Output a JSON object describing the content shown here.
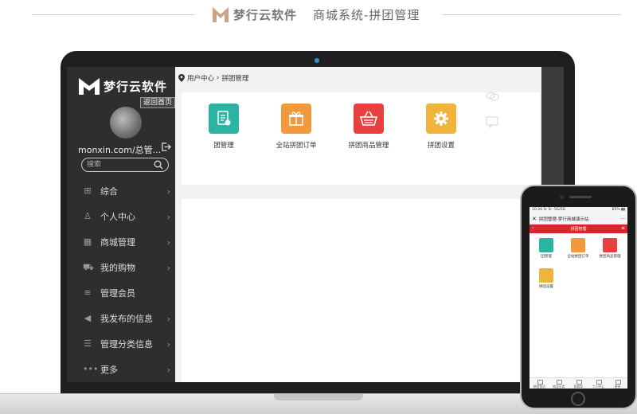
{
  "banner": {
    "brand": "梦行云软件",
    "subtitle": "商城系统-拼团管理"
  },
  "sidebar": {
    "brand": "梦行云软件",
    "return_label": "返回首页",
    "username": "monxin.com/总管...",
    "search_placeholder": "搜索",
    "items": [
      {
        "label": "综合",
        "icon": "grid-icon"
      },
      {
        "label": "个人中心",
        "icon": "user-icon"
      },
      {
        "label": "商城管理",
        "icon": "store-icon"
      },
      {
        "label": "我的购物",
        "icon": "cart-icon"
      },
      {
        "label": "管理会员",
        "icon": "layers-icon"
      },
      {
        "label": "我发布的信息",
        "icon": "megaphone-icon"
      },
      {
        "label": "管理分类信息",
        "icon": "list-icon"
      },
      {
        "label": "更多",
        "icon": "more-dots-icon"
      }
    ]
  },
  "breadcrumb": {
    "home": "用户中心",
    "separator": "›",
    "current": "拼团管理"
  },
  "tiles": [
    {
      "label": "团管理",
      "color": "#2bb3a4",
      "icon": "team-doc-icon"
    },
    {
      "label": "全站拼团订单",
      "color": "#f29a3b",
      "icon": "gift-icon"
    },
    {
      "label": "拼团商品管理",
      "color": "#e84040",
      "icon": "basket-icon"
    },
    {
      "label": "拼团设置",
      "color": "#f0b43c",
      "icon": "gear-icon"
    }
  ],
  "phone": {
    "status_left": "10:34 5r 5r ·5G/5G",
    "status_right": "85% ▮▮",
    "title": "拼团管理-梦行商城演示站",
    "bar_title": "拼团管理",
    "tiles": [
      {
        "label": "团管理",
        "color": "#2bb3a4"
      },
      {
        "label": "全站拼团订单",
        "color": "#f29a3b"
      },
      {
        "label": "拼团商品管理",
        "color": "#e84040"
      },
      {
        "label": "拼团设置",
        "color": "#f0b43c"
      }
    ],
    "footer": [
      "拼团首页",
      "商品分类",
      "购物车",
      "个人中心",
      "更多"
    ]
  }
}
